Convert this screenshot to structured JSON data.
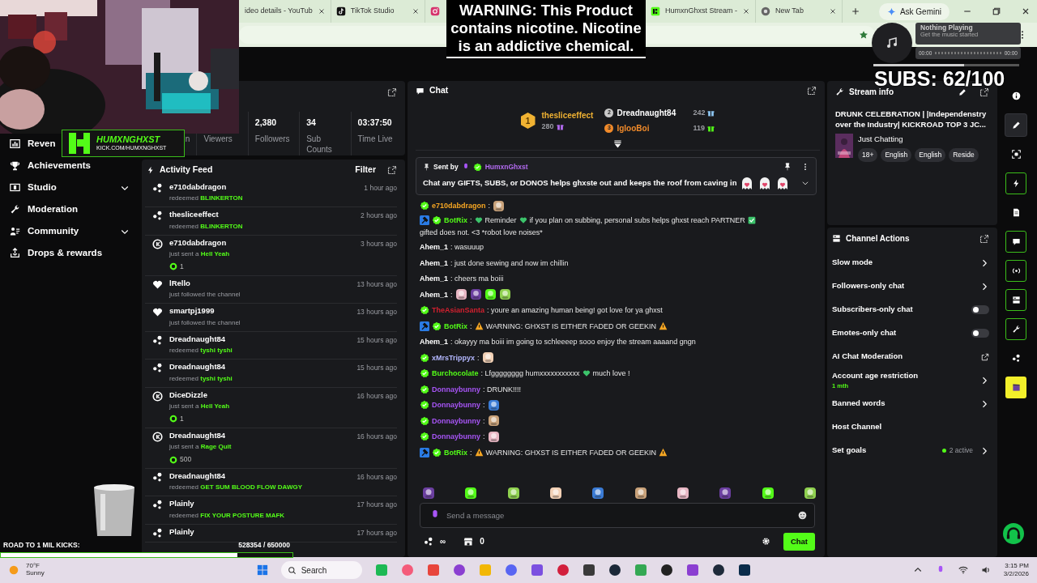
{
  "browser": {
    "tabs": [
      {
        "kind": "page",
        "title": "ideo details - YouTub"
      },
      {
        "kind": "tiktok",
        "title": "TikTok Studio"
      },
      {
        "kind": "instagram"
      },
      {
        "kind": "kick",
        "title": "HumxnGhxst Stream -"
      },
      {
        "kind": "chrome",
        "title": "New Tab"
      }
    ],
    "ask_button": "Ask Gemini"
  },
  "overlay": {
    "logo": {
      "name": "HUMXNGHXST",
      "url": "KICK.COM/HUMXNGHXST"
    },
    "warning": "WARNING: This Product contains nicotine. Nicotine is an addictive chemical.",
    "music": {
      "title": "Nothing Playing",
      "subtitle": "Get the music started",
      "elapsed": "00:00",
      "total": "00:00"
    },
    "subs": {
      "text": "SUBS: 62/100",
      "level": 0.62
    },
    "road": {
      "label": "ROAD TO 1 MIL KICKS:",
      "count": "528354 / 650000",
      "level": 0.81
    }
  },
  "sidebar": {
    "items": [
      {
        "kind": "revenue",
        "label": "Reven"
      },
      {
        "kind": "trophy",
        "label": "Achievements"
      },
      {
        "kind": "studio",
        "label": "Studio",
        "expandable": true
      },
      {
        "kind": "wrench",
        "label": "Moderation"
      },
      {
        "kind": "community",
        "label": "Community",
        "expandable": true
      },
      {
        "kind": "drops",
        "label": "Drops & rewards"
      }
    ]
  },
  "stats": [
    {
      "label": "n"
    },
    {
      "label": "Viewers"
    },
    {
      "value": "2,380",
      "label": "Followers"
    },
    {
      "value": "34",
      "label": "Sub Counts"
    },
    {
      "value": "03:37:50",
      "label": "Time Live"
    }
  ],
  "activity_feed": {
    "title": "Activity Feed",
    "filter": "Filter",
    "items": [
      {
        "kind": "redeem",
        "user": "e710dabdragon",
        "action": "redeemed",
        "highlight": "BLINKERTON",
        "time": "1 hour ago"
      },
      {
        "kind": "redeem",
        "user": "thesliceeffect",
        "action": "redeemed",
        "highlight": "BLINKERTON",
        "time": "2 hours ago"
      },
      {
        "kind": "kicks",
        "user": "e710dabdragon",
        "action": "just sent a",
        "highlight": "Hell Yeah",
        "amount": "1",
        "time": "3 hours ago"
      },
      {
        "kind": "follow",
        "user": "lRello",
        "action": "just followed the channel",
        "time": "13 hours ago"
      },
      {
        "kind": "follow",
        "user": "smartpj1999",
        "action": "just followed the channel",
        "time": "13 hours ago"
      },
      {
        "kind": "redeem",
        "user": "Dreadnaught84",
        "action": "redeemed",
        "highlight": "tyshi tyshi",
        "time": "15 hours ago"
      },
      {
        "kind": "redeem",
        "user": "Dreadnaught84",
        "action": "redeemed",
        "highlight": "tyshi tyshi",
        "time": "15 hours ago"
      },
      {
        "kind": "kicks",
        "user": "DiceDizzle",
        "action": "just sent a",
        "highlight": "Hell Yeah",
        "amount": "1",
        "time": "16 hours ago"
      },
      {
        "kind": "kicks",
        "user": "Dreadnaught84",
        "action": "just sent a",
        "highlight": "Rage Quit",
        "amount": "500",
        "time": "16 hours ago"
      },
      {
        "kind": "redeem",
        "user": "Dreadnaught84",
        "action": "redeemed",
        "highlight": "GET SUM BLOOD FLOW DAWGY",
        "time": "16 hours ago"
      },
      {
        "kind": "redeem",
        "user": "Plainly",
        "action": "redeemed",
        "highlight": "FIX YOUR POSTURE MAFK",
        "time": "17 hours ago"
      },
      {
        "kind": "redeem",
        "user": "Plainly",
        "time": "17 hours ago"
      }
    ]
  },
  "chat": {
    "title": "Chat",
    "leaderboard": [
      {
        "rank": "1",
        "user": "thesliceeffect",
        "count": "280",
        "color": "#b36bf0"
      },
      {
        "rank": "2",
        "user": "Dreadnaught84",
        "count": "242",
        "color": "#8cc4f0"
      },
      {
        "rank": "3",
        "user": "IglooBoi",
        "count": "119",
        "color": "#53fc18"
      }
    ],
    "pinned": {
      "label": "Sent by",
      "user": "HumxnGhxst",
      "text": "Chat any GIFTS, SUBS, or DONOS helps ghxste out and keeps the roof from caving in",
      "parts": [
        {
          "kind": "emote"
        },
        {
          "kind": "emote"
        },
        {
          "kind": "emote"
        }
      ]
    },
    "messages": [
      {
        "user": "e710dabdragon",
        "color": "#f6a623",
        "verified": true,
        "bot": false,
        "parts": [
          {
            "kind": "text",
            "text": ":"
          },
          {
            "kind": "emote"
          }
        ]
      },
      {
        "user": "BotRix",
        "color": "#53fc18",
        "verified": true,
        "bot": true,
        "parts": [
          {
            "kind": "text",
            "text": ":"
          },
          {
            "kind": "heart"
          },
          {
            "kind": "text",
            "text": "Reminder"
          },
          {
            "kind": "heart"
          },
          {
            "kind": "text",
            "text": "if you plan on subbing, personal subs helps ghxst reach PARTNER"
          },
          {
            "kind": "check"
          },
          {
            "kind": "text",
            "text": "gifted does not. <3 *robot love noises*"
          }
        ]
      },
      {
        "user": "Ahem_1",
        "color": "#ffffff",
        "verified": false,
        "bot": false,
        "parts": [
          {
            "kind": "text",
            "text": ": wasuuup"
          }
        ]
      },
      {
        "user": "Ahem_1",
        "color": "#ffffff",
        "verified": false,
        "bot": false,
        "parts": [
          {
            "kind": "text",
            "text": ": just done sewing and now im chillin"
          }
        ]
      },
      {
        "user": "Ahem_1",
        "color": "#ffffff",
        "verified": false,
        "bot": false,
        "parts": [
          {
            "kind": "text",
            "text": ": cheers ma boiii"
          }
        ]
      },
      {
        "user": "Ahem_1",
        "color": "#ffffff",
        "verified": false,
        "bot": false,
        "parts": [
          {
            "kind": "text",
            "text": ":"
          },
          {
            "kind": "emote"
          },
          {
            "kind": "emote"
          },
          {
            "kind": "emote"
          },
          {
            "kind": "emote"
          }
        ]
      },
      {
        "user": "TheAsianSanta",
        "color": "#d2202f",
        "verified": true,
        "bot": false,
        "parts": [
          {
            "kind": "text",
            "text": ": youre an amazing human being! got love for ya ghxst"
          }
        ]
      },
      {
        "user": "BotRix",
        "color": "#53fc18",
        "verified": true,
        "bot": true,
        "parts": [
          {
            "kind": "text",
            "text": ":"
          },
          {
            "kind": "warning"
          },
          {
            "kind": "text",
            "text": "WARNING: GHXST IS EITHER FADED OR GEEKIN"
          },
          {
            "kind": "warning"
          }
        ]
      },
      {
        "user": "Ahem_1",
        "color": "#ffffff",
        "verified": false,
        "bot": false,
        "parts": [
          {
            "kind": "text",
            "text": ": okayyy ma boiii im going to schleeeep sooo enjoy the stream aaaand gngn"
          }
        ]
      },
      {
        "user": "xMrsTrippyx",
        "color": "#b4b8ff",
        "verified": true,
        "bot": false,
        "parts": [
          {
            "kind": "text",
            "text": ":"
          },
          {
            "kind": "emote"
          }
        ]
      },
      {
        "user": "Burchocolate",
        "color": "#53fc18",
        "verified": true,
        "bot": false,
        "parts": [
          {
            "kind": "text",
            "text": ": Lfgggggggg humxxxxxxxxxxx"
          },
          {
            "kind": "heart"
          },
          {
            "kind": "text",
            "text": "much love !"
          }
        ]
      },
      {
        "user": "Donnaybunny",
        "color": "#a855f7",
        "verified": true,
        "bot": false,
        "parts": [
          {
            "kind": "text",
            "text": ": DRUNK!!!!"
          }
        ]
      },
      {
        "user": "Donnaybunny",
        "color": "#a855f7",
        "verified": true,
        "bot": false,
        "parts": [
          {
            "kind": "text",
            "text": ":"
          },
          {
            "kind": "emote"
          }
        ]
      },
      {
        "user": "Donnaybunny",
        "color": "#a855f7",
        "verified": true,
        "bot": false,
        "parts": [
          {
            "kind": "text",
            "text": ":"
          },
          {
            "kind": "emote"
          }
        ]
      },
      {
        "user": "Donnaybunny",
        "color": "#a855f7",
        "verified": true,
        "bot": false,
        "parts": [
          {
            "kind": "text",
            "text": ":"
          },
          {
            "kind": "emote"
          }
        ]
      },
      {
        "user": "BotRix",
        "color": "#53fc18",
        "verified": true,
        "bot": true,
        "parts": [
          {
            "kind": "text",
            "text": ":"
          },
          {
            "kind": "warning"
          },
          {
            "kind": "text",
            "text": "WARNING: GHXST IS EITHER FADED OR GEEKIN"
          },
          {
            "kind": "warning"
          }
        ]
      }
    ],
    "input": {
      "placeholder": "Send a message"
    },
    "points": "∞",
    "store": "0",
    "send": "Chat"
  },
  "stream_info": {
    "title": "Stream info",
    "stream_title": "DRUNK CELEBRATION | |Independenstry over the Industry| KICKROAD TOP 3 JC...",
    "category": "Just Chatting",
    "tags": [
      "18+",
      "English",
      "English",
      "Reside"
    ]
  },
  "channel_actions": {
    "title": "Channel Actions",
    "items": [
      {
        "kind": "chevron",
        "label": "Slow mode"
      },
      {
        "kind": "chevron",
        "label": "Followers-only chat"
      },
      {
        "kind": "toggle",
        "label": "Subscribers-only chat",
        "on": false
      },
      {
        "kind": "toggle",
        "label": "Emotes-only chat",
        "on": false
      },
      {
        "kind": "external",
        "label": "AI Chat Moderation"
      },
      {
        "kind": "chevron",
        "label": "Account age restriction",
        "detail": "1 mth"
      },
      {
        "kind": "chevron",
        "label": "Banned words"
      },
      {
        "kind": "plain",
        "label": "Host Channel"
      },
      {
        "kind": "chevron",
        "label": "Set goals",
        "status": "2 active"
      }
    ]
  },
  "rail": [
    {
      "kind": "info",
      "active": false,
      "selected": false
    },
    {
      "kind": "pencil",
      "active": false,
      "selected": true
    },
    {
      "kind": "capture",
      "active": false,
      "selected": false
    },
    {
      "kind": "bolt",
      "active": true,
      "selected": false
    },
    {
      "kind": "doc",
      "active": false,
      "selected": false
    },
    {
      "kind": "chat",
      "active": true,
      "selected": false
    },
    {
      "kind": "broadcast",
      "active": true,
      "selected": false
    },
    {
      "kind": "channel",
      "active": true,
      "selected": false
    },
    {
      "kind": "wrench",
      "active": true,
      "selected": false
    },
    {
      "kind": "dots",
      "active": false,
      "selected": false
    },
    {
      "kind": "clapper",
      "active": false,
      "selected": false,
      "color": "#f2ef2a"
    }
  ],
  "taskbar": {
    "temperature": "70°F",
    "weather": "Sunny",
    "search": "Search",
    "apps": [
      {
        "color": "#1db954"
      },
      {
        "color": "#f45b7a"
      },
      {
        "color": "#e8453c"
      },
      {
        "color": "#8b3fd1"
      },
      {
        "color": "#f2b705"
      },
      {
        "color": "#5865f2"
      },
      {
        "color": "#7b4fe0"
      },
      {
        "color": "#d21f3c"
      },
      {
        "color": "#3a3a3a"
      },
      {
        "color": "#1b2838"
      },
      {
        "color": "#34a853"
      },
      {
        "color": "#222222"
      },
      {
        "color": "#8b3fd1"
      },
      {
        "color": "#1e2a3a"
      },
      {
        "color": "#0a2b4a"
      }
    ],
    "time": "3:15 PM",
    "date": "3/2/2026"
  }
}
